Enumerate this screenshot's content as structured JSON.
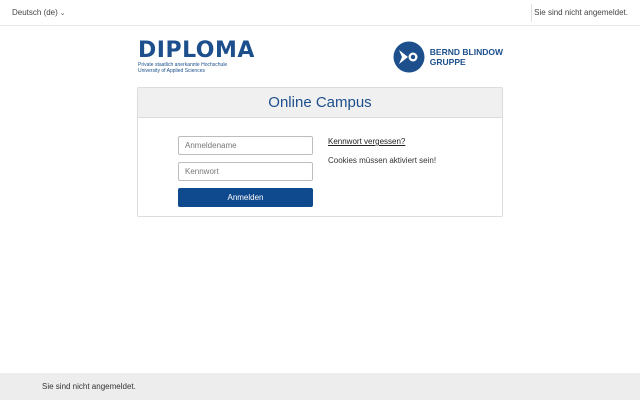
{
  "topbar": {
    "language": "Deutsch (de)",
    "status": "Sie sind nicht angemeldet."
  },
  "logos": {
    "diploma_name": "DIPLOMA",
    "diploma_sub1": "Private staatlich anerkannte Hochschule",
    "diploma_sub2": "University of Applied Sciences",
    "bb_line1": "BERND BLINDOW",
    "bb_line2": "GRUPPE"
  },
  "login": {
    "title": "Online Campus",
    "username_placeholder": "Anmeldename",
    "username_value": "",
    "password_placeholder": "Kennwort",
    "password_value": "",
    "submit_label": "Anmelden",
    "forgot_label": "Kennwort vergessen?",
    "cookies_notice": "Cookies müssen aktiviert sein!"
  },
  "footer": {
    "status": "Sie sind nicht angemeldet."
  },
  "colors": {
    "brand": "#1c4f8c",
    "button": "#104a8e",
    "footer_bg": "#ededed",
    "header_bg": "#f0f0f0"
  }
}
